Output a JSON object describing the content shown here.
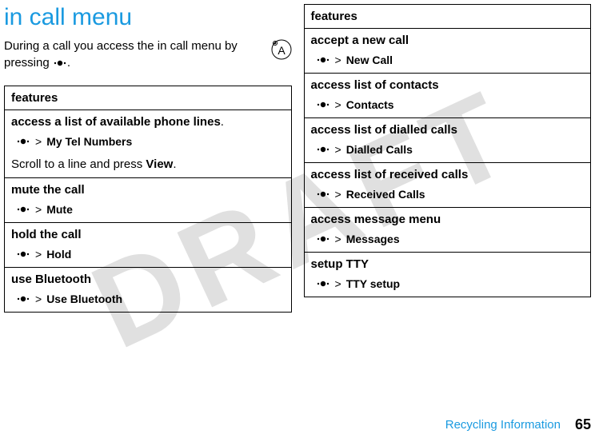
{
  "watermark": "DRAFT",
  "header": {
    "title": "in call menu",
    "intro": "During a call you access the in call menu by pressing",
    "intro_suffix": "."
  },
  "icons": {
    "antenna": "antenna-icon",
    "center_key": "center-key-icon"
  },
  "tables": {
    "left": {
      "header": "features",
      "rows": [
        {
          "title": "access a list of available phone lines",
          "title_suffix": ".",
          "command": "My Tel Numbers",
          "note_prefix": "Scroll to a line and press ",
          "note_bold": "View",
          "note_suffix": "."
        },
        {
          "title": "mute the call",
          "command": "Mute"
        },
        {
          "title": "hold the call",
          "command": "Hold"
        },
        {
          "title": "use Bluetooth",
          "command": "Use Bluetooth"
        }
      ]
    },
    "right": {
      "header": "features",
      "rows": [
        {
          "title": "accept a new call",
          "command": "New Call"
        },
        {
          "title": "access list of contacts",
          "command": "Contacts"
        },
        {
          "title": "access list of dialled calls",
          "command": "Dialled Calls"
        },
        {
          "title": "access list of received calls",
          "command": "Received Calls"
        },
        {
          "title": "access message menu",
          "command": "Messages"
        },
        {
          "title": "setup TTY",
          "command": "TTY setup"
        }
      ]
    }
  },
  "footer": {
    "link": "Recycling Information",
    "page": "65"
  },
  "symbols": {
    "gt": ">"
  }
}
